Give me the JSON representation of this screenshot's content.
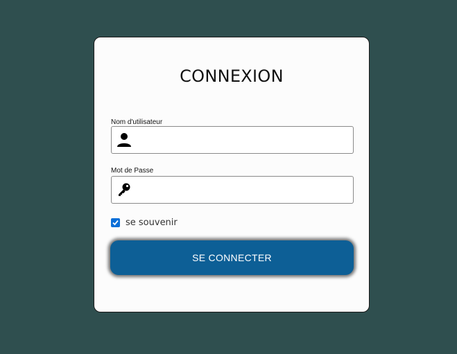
{
  "form": {
    "title": "CONNEXION",
    "username": {
      "label": "Nom d'utilisateur",
      "value": "",
      "placeholder": "",
      "icon": "user-icon"
    },
    "password": {
      "label": "Mot de Passe",
      "value": "",
      "placeholder": "",
      "icon": "key-icon"
    },
    "remember": {
      "label": "se souvenir",
      "checked": true
    },
    "submit_label": "SE CONNECTER"
  },
  "colors": {
    "page_background": "#2f4f4f",
    "card_background": "#fcfcfc",
    "button_background": "#0d5f96",
    "checkbox_accent": "#0b6fd8"
  }
}
